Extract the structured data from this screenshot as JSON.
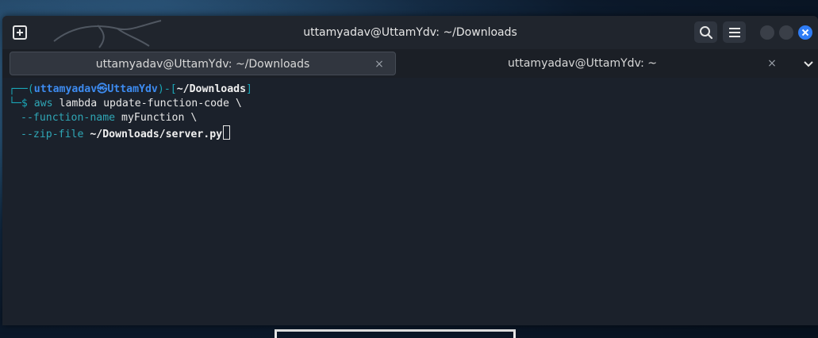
{
  "window": {
    "title": "uttamyadav@UttamYdv: ~/Downloads"
  },
  "icons": {
    "new_tab": "new-tab-icon",
    "search": "search-icon",
    "menu": "hamburger-menu-icon",
    "close": "close-icon",
    "tab_close": "close-icon",
    "tabs_menu": "chevron-down-icon"
  },
  "tabs": [
    {
      "label": "uttamyadav@UttamYdv: ~/Downloads",
      "active": true
    },
    {
      "label": "uttamyadav@UttamYdv: ~",
      "active": false
    }
  ],
  "tab_close_glyph": "×",
  "terminal": {
    "prompt": {
      "frame_top": "┌──(",
      "user": "uttamyadav㉿UttamYdv",
      "sep": ")-[",
      "cwd": "~/Downloads",
      "close": "]",
      "frame_bottom": "└─$ "
    },
    "command": {
      "name": "aws",
      "args": " lambda update-function-code \\",
      "opt1": "--function-name",
      "opt1_value": " myFunction \\",
      "opt2": "--zip-file",
      "opt2_value": " ~/Downloads/server.py"
    }
  },
  "colors": {
    "close_button": "#2f7df6",
    "prompt_frame": "#1aa6b7",
    "prompt_user": "#3d8bf0",
    "terminal_bg": "#1b212b"
  }
}
